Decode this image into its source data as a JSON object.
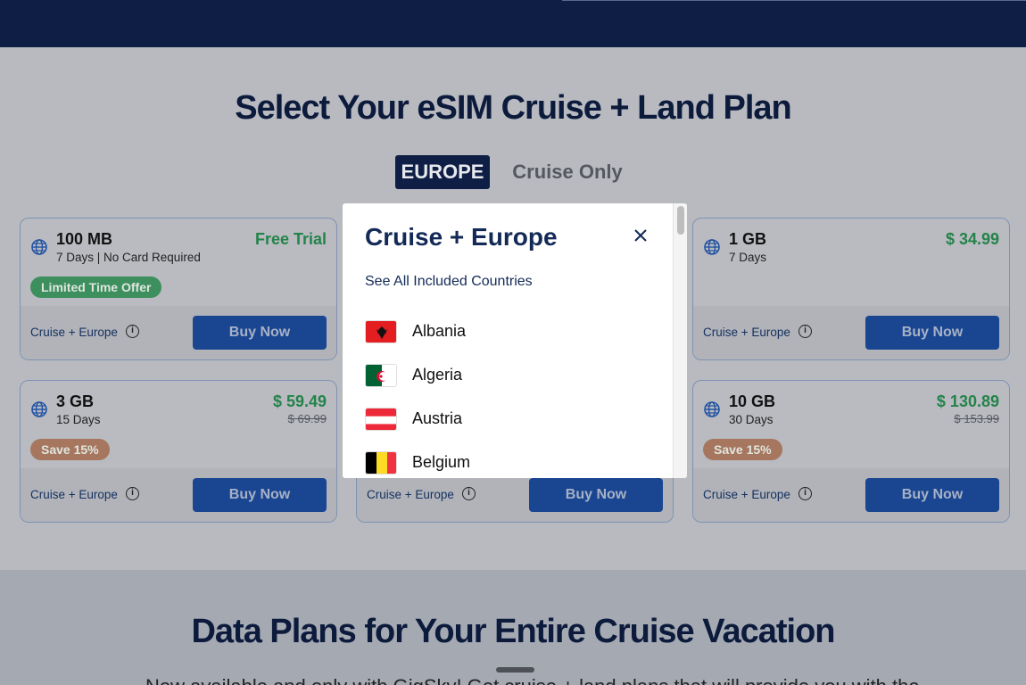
{
  "header": {
    "title_prefix": "Select Your eSIM ",
    "title_bold": "Cruise + Land",
    "title_suffix": " Plan"
  },
  "tabs": {
    "active": "EUROPE",
    "inactive": "Cruise Only"
  },
  "plans": [
    {
      "data": "100 MB",
      "days": "7 Days | No Card Required",
      "price": "Free Trial",
      "old_price": "",
      "badge": "Limited Time Offer",
      "region": "Cruise + Europe",
      "button": "Buy Now"
    },
    {
      "data": "",
      "days": "",
      "price": "",
      "old_price": "",
      "badge": "",
      "region": "",
      "button": ""
    },
    {
      "data": "1 GB",
      "days": "7 Days",
      "price": "$ 34.99",
      "old_price": "",
      "badge": "",
      "region": "Cruise + Europe",
      "button": "Buy Now"
    },
    {
      "data": "3 GB",
      "days": "15 Days",
      "price": "$ 59.49",
      "old_price": "$ 69.99",
      "badge": "Save 15%",
      "region": "Cruise + Europe",
      "button": "Buy Now"
    },
    {
      "data": "",
      "days": "",
      "price": "",
      "old_price": "",
      "badge": "",
      "region": "Cruise + Europe",
      "button": "Buy Now"
    },
    {
      "data": "10 GB",
      "days": "30 Days",
      "price": "$ 130.89",
      "old_price": "$ 153.99",
      "badge": "Save 15%",
      "region": "Cruise + Europe",
      "button": "Buy Now"
    }
  ],
  "modal": {
    "title": "Cruise + Europe",
    "see_all": "See All Included Countries",
    "countries": [
      {
        "name": "Albania",
        "flag_icon": "albania-flag-icon"
      },
      {
        "name": "Algeria",
        "flag_icon": "algeria-flag-icon"
      },
      {
        "name": "Austria",
        "flag_icon": "austria-flag-icon"
      },
      {
        "name": "Belgium",
        "flag_icon": "belgium-flag-icon"
      }
    ]
  },
  "lower": {
    "title": "Data Plans for Your Entire Cruise Vacation",
    "text": "Now available and only with GigSky! Get cruise + land plans that will provide you with the"
  },
  "colors": {
    "navy": "#0f1e44",
    "price_green": "#24834a",
    "button_blue": "#1a4691",
    "badge_green": "#3d8f5e",
    "badge_orange": "#a6765e"
  },
  "icons": {
    "globe": "globe-icon",
    "info": "info-icon",
    "close": "close-icon"
  }
}
